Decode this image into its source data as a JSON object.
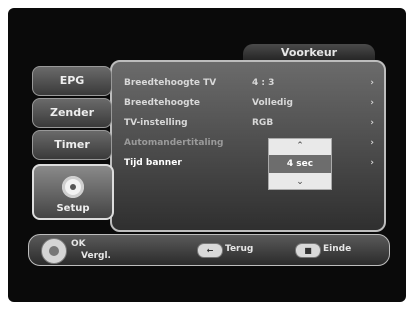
{
  "header": {
    "title": "Voorkeur"
  },
  "sidebar": {
    "items": [
      {
        "label": "EPG"
      },
      {
        "label": "Zender"
      },
      {
        "label": "Timer"
      },
      {
        "label": "Setup"
      }
    ]
  },
  "settings": [
    {
      "label": "Breedtehoogte TV",
      "value": "4 : 3",
      "arrow": "›"
    },
    {
      "label": "Breedtehoogte",
      "value": "Volledig",
      "arrow": "›"
    },
    {
      "label": "TV-instelling",
      "value": "RGB",
      "arrow": "›"
    },
    {
      "label": "Automandertitaling",
      "value": "",
      "arrow": "›"
    },
    {
      "label": "Tijd banner",
      "value": "",
      "arrow": "›"
    }
  ],
  "popup": {
    "up": "⌃",
    "selected": "4 sec",
    "down": "⌄"
  },
  "bottom_bar": {
    "ok": "OK",
    "vergl": "Vergl.",
    "terug_key": "←",
    "terug": "Terug",
    "einde_key": "■",
    "einde": "Einde"
  }
}
